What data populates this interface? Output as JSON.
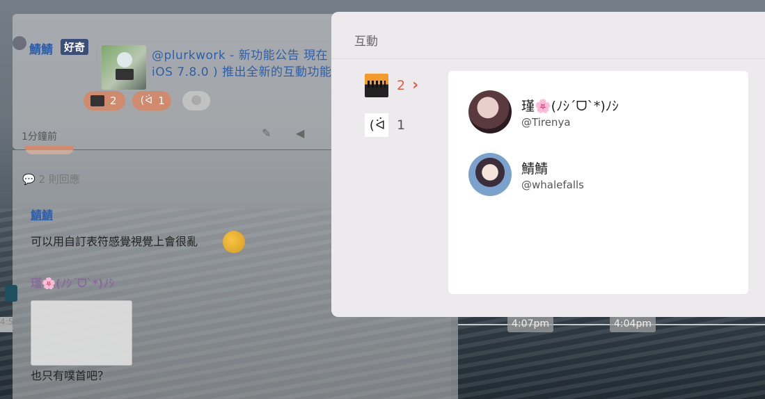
{
  "plurk": {
    "poster_name": "鯖鯖",
    "qualifier": "好奇",
    "content_line1": "@plurkwork - 新功能公告 現在",
    "content_line2": "iOS 7.8.0 ) 推出全新的互動功能",
    "reactions": [
      {
        "count": "2"
      },
      {
        "kaomoji": "(ᐛ",
        "count": "1"
      }
    ],
    "time_ago": "1分鐘前"
  },
  "replies": {
    "count_label": "2 則回應",
    "items": [
      {
        "name": "鯖鯖",
        "text": "可以用自訂表符感覺視覺上會很亂"
      },
      {
        "name": "瑾🌸(ﾉｼ´ᗜ`*)ﾉｼ",
        "text": "也只有噗首吧？"
      }
    ]
  },
  "timeline": {
    "tags": [
      "4:07pm",
      "4:04pm"
    ],
    "left_fragment": "4:5"
  },
  "modal": {
    "title": "互動",
    "tabs": [
      {
        "count": "2",
        "active": true
      },
      {
        "kaomoji": "(ᐛ",
        "count": "1",
        "active": false
      }
    ],
    "users": [
      {
        "display_name": "瑾🌸(ﾉｼ´ᗜ`*)ﾉｼ",
        "handle": "@Tirenya"
      },
      {
        "display_name": "鯖鯖",
        "handle": "@whalefalls"
      }
    ]
  },
  "colors": {
    "accent": "#e25b45",
    "link": "#2d5fa8",
    "modal_bg": "#edeaee",
    "panel_bg": "#ffffff"
  }
}
